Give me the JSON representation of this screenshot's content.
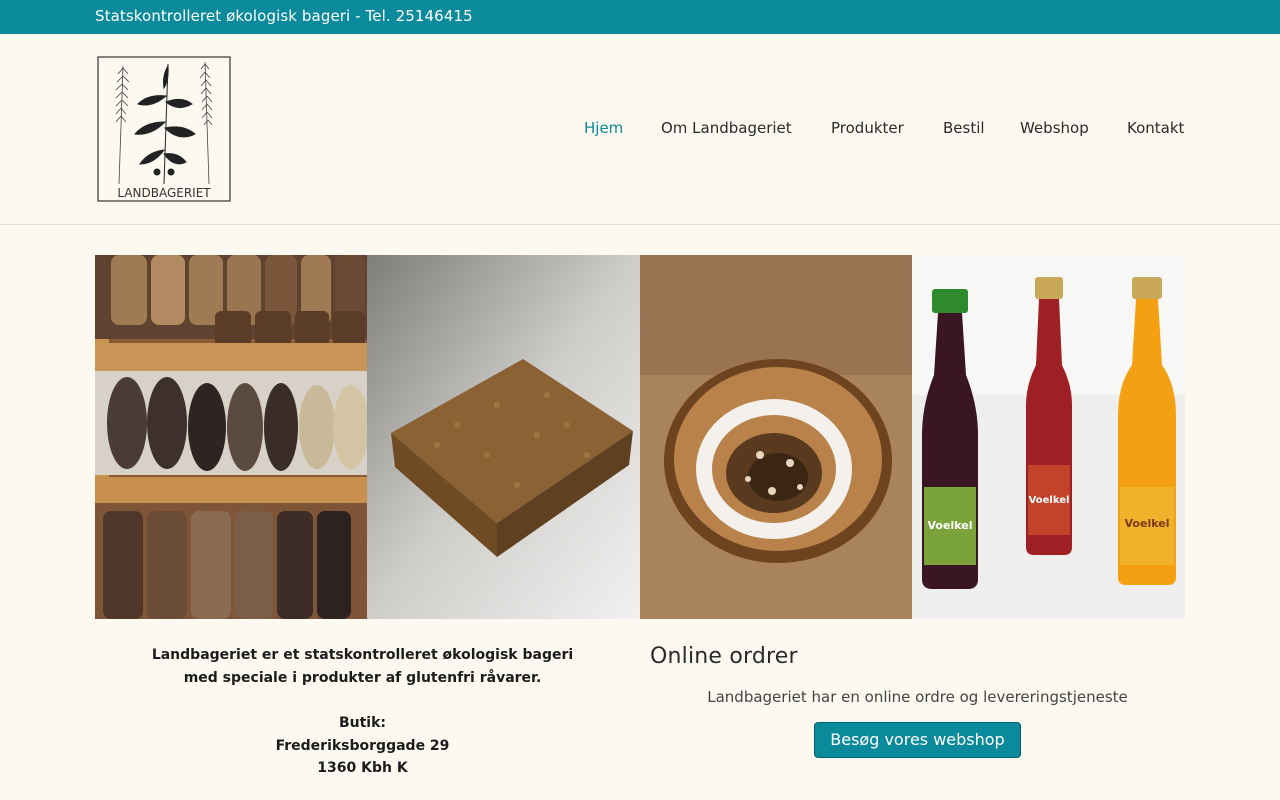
{
  "topbar": {
    "text": "Statskontrolleret økologisk bageri - Tel. 25146415"
  },
  "logo": {
    "wordmark": "LANDBAGERIET",
    "icon": "wheat-and-plant-drawing"
  },
  "nav": {
    "items": [
      {
        "label": "Hjem",
        "active": true
      },
      {
        "label": "Om Landbageriet",
        "active": false
      },
      {
        "label": "Produkter",
        "active": false
      },
      {
        "label": "Bestil",
        "active": false
      },
      {
        "label": "Webshop",
        "active": false
      },
      {
        "label": "Kontakt",
        "active": false
      }
    ]
  },
  "gallery": {
    "photos": [
      "bread-shelves-photo",
      "glutenfree-bar-photo",
      "pastry-photo",
      "juice-bottles-photo"
    ]
  },
  "intro": {
    "line1": "Landbageriet er et statskontrolleret økologisk bageri",
    "line2": "med speciale i produkter af glutenfri råvarer.",
    "shop_heading": "Butik:",
    "street": "Frederiksborggade 29",
    "city": "1360 Kbh K"
  },
  "online": {
    "title": "Online ordrer",
    "text": "Landbageriet har en online ordre og levereringstjeneste",
    "button": "Besøg vores webshop"
  },
  "colors": {
    "accent": "#0a8a9b",
    "background": "#fcf9f1"
  }
}
